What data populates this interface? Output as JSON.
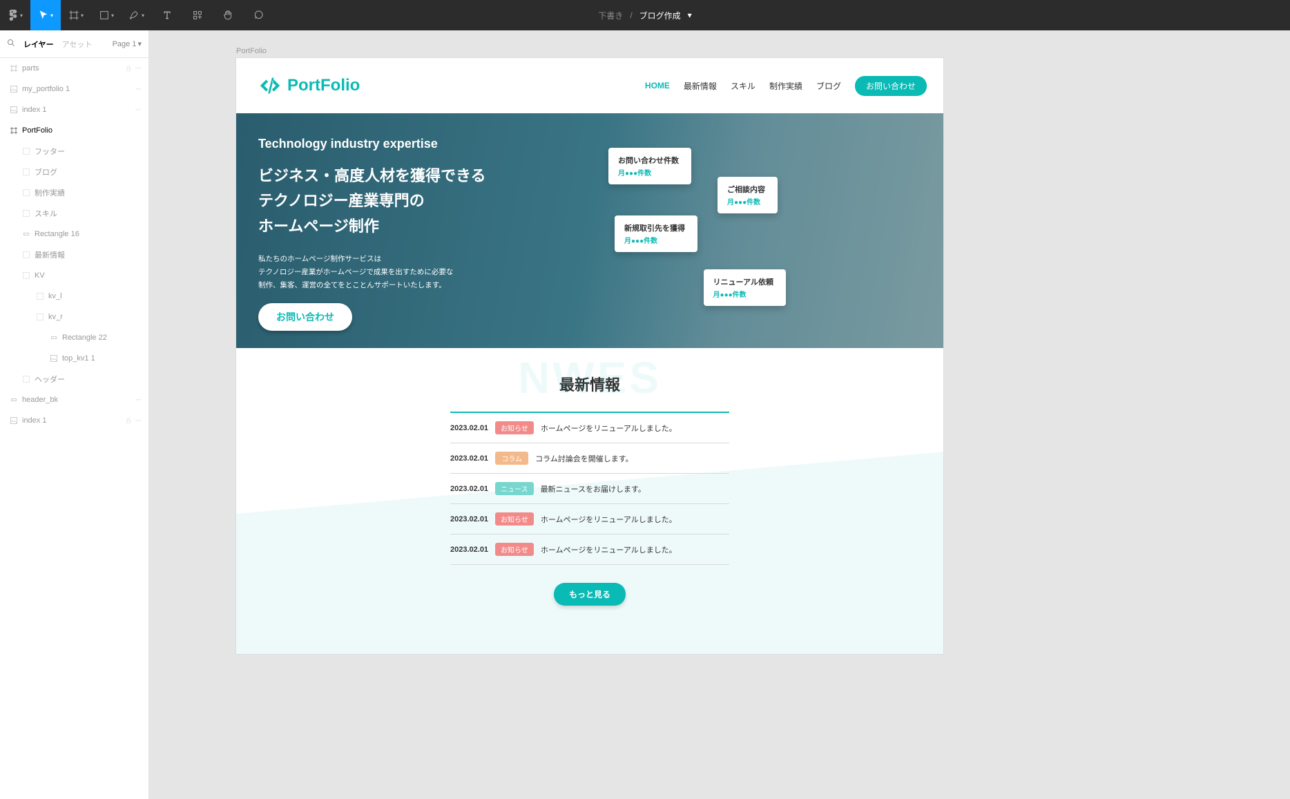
{
  "toolbar": {
    "crumb_muted": "下書き",
    "crumb_active": "ブログ作成"
  },
  "sidebar": {
    "tab_layers": "レイヤー",
    "tab_assets": "アセット",
    "page_selector": "Page 1",
    "layers": [
      {
        "name": "parts",
        "lvl": "l1",
        "icon": "frame",
        "lock": true,
        "hide": true
      },
      {
        "name": "my_portfolio 1",
        "lvl": "l1",
        "icon": "img",
        "hide": true
      },
      {
        "name": "index 1",
        "lvl": "l1",
        "icon": "img",
        "hide": true
      },
      {
        "name": "PortFolio",
        "lvl": "l1",
        "icon": "frame",
        "strong": true
      },
      {
        "name": "フッター",
        "lvl": "l2",
        "icon": "grp"
      },
      {
        "name": "ブログ",
        "lvl": "l2",
        "icon": "grp"
      },
      {
        "name": "制作実績",
        "lvl": "l2",
        "icon": "grp"
      },
      {
        "name": "スキル",
        "lvl": "l2",
        "icon": "grp"
      },
      {
        "name": "Rectangle 16",
        "lvl": "l2",
        "icon": "rect"
      },
      {
        "name": "最新情報",
        "lvl": "l2",
        "icon": "grp"
      },
      {
        "name": "KV",
        "lvl": "l2",
        "icon": "grp"
      },
      {
        "name": "kv_l",
        "lvl": "l3",
        "icon": "grp"
      },
      {
        "name": "kv_r",
        "lvl": "l3",
        "icon": "grp"
      },
      {
        "name": "Rectangle 22",
        "lvl": "l4",
        "icon": "rect"
      },
      {
        "name": "top_kv1 1",
        "lvl": "l4",
        "icon": "img"
      },
      {
        "name": "ヘッダー",
        "lvl": "l2",
        "icon": "grp"
      },
      {
        "name": "header_bk",
        "lvl": "l1",
        "icon": "rect",
        "hide": true
      },
      {
        "name": "index 1",
        "lvl": "l1",
        "icon": "img",
        "lock": true,
        "hide": true
      }
    ]
  },
  "frame": {
    "label": "PortFolio",
    "logo": "PortFolio",
    "nav": [
      "HOME",
      "最新情報",
      "スキル",
      "制作実績",
      "ブログ"
    ],
    "nav_cta": "お問い合わせ",
    "kv": {
      "tag": "Technology industry expertise",
      "h1": "ビジネス・高度人材を獲得できる",
      "h2": "テクノロジー産業専門の",
      "h3": "ホームページ制作",
      "d1": "私たちのホームページ制作サービスは",
      "d2": "テクノロジー産業がホームページで成果を出すために必要な",
      "d3": "制作、集客、運営の全てをとことんサポートいたします。",
      "btn": "お問い合わせ",
      "bubbles": [
        {
          "t": "お問い合わせ件数",
          "s": "月●●●件数"
        },
        {
          "t": "ご相談内容",
          "s": "月●●●件数"
        },
        {
          "t": "新規取引先を獲得",
          "s": "月●●●件数"
        },
        {
          "t": "リニューアル依頼",
          "s": "月●●●件数"
        }
      ]
    },
    "news": {
      "bg": "NWES",
      "title": "最新情報",
      "more": "もっと見る",
      "rows": [
        {
          "date": "2023.02.01",
          "tag": "お知らせ",
          "cls": "tag-notice",
          "txt": "ホームページをリニューアルしました。"
        },
        {
          "date": "2023.02.01",
          "tag": "コラム",
          "cls": "tag-column",
          "txt": "コラム討論会を開催します。"
        },
        {
          "date": "2023.02.01",
          "tag": "ニュース",
          "cls": "tag-news",
          "txt": "最新ニュースをお届けします。"
        },
        {
          "date": "2023.02.01",
          "tag": "お知らせ",
          "cls": "tag-notice",
          "txt": "ホームページをリニューアルしました。"
        },
        {
          "date": "2023.02.01",
          "tag": "お知らせ",
          "cls": "tag-notice",
          "txt": "ホームページをリニューアルしました。"
        }
      ]
    }
  }
}
